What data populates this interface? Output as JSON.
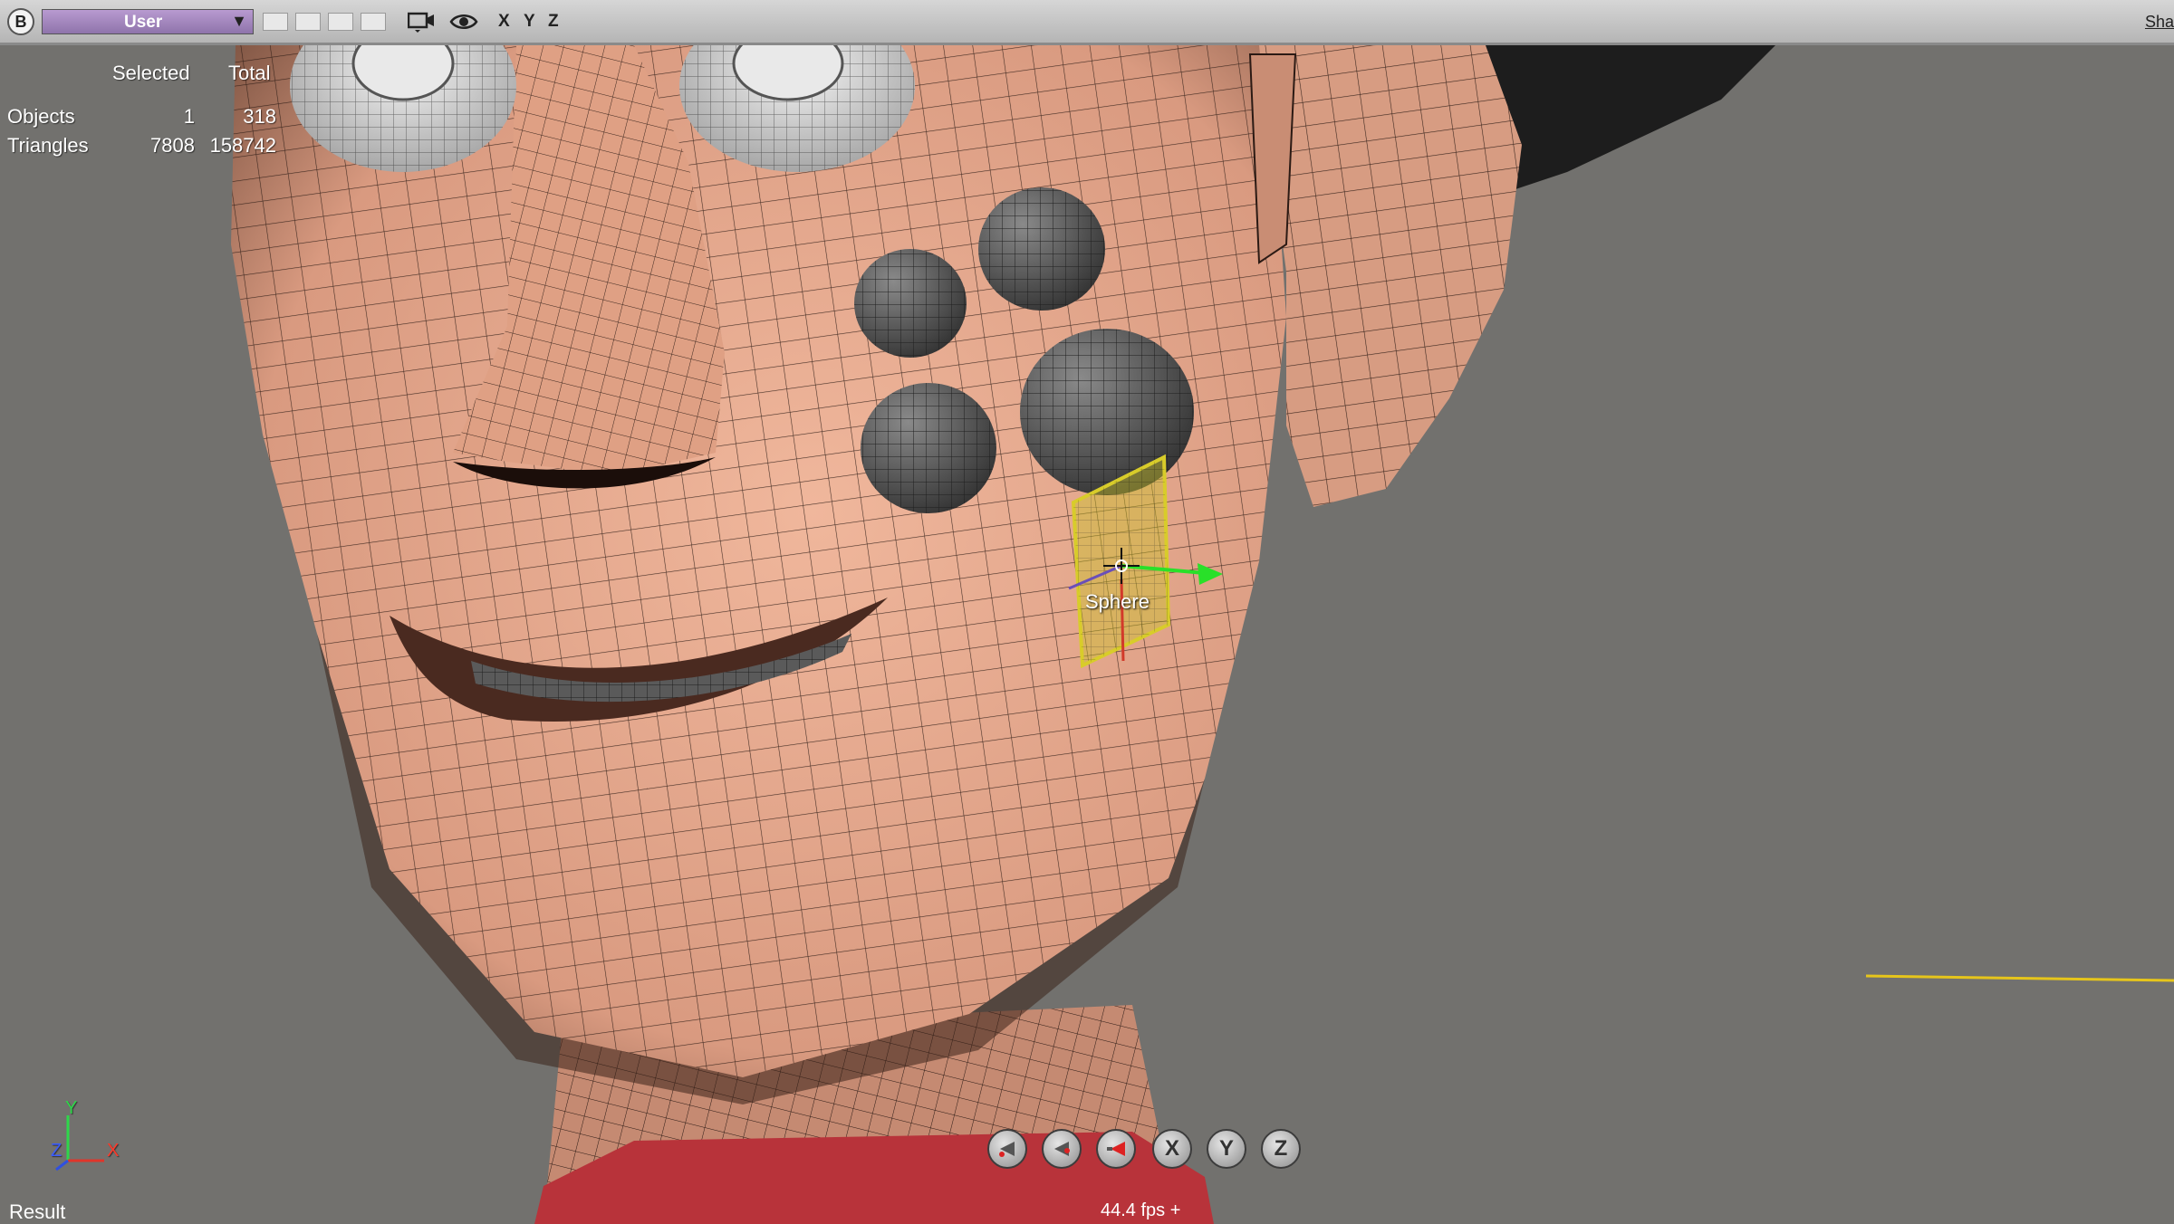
{
  "toolbar": {
    "logo": "B",
    "view_mode": "User",
    "axes": [
      "X",
      "Y",
      "Z"
    ],
    "right_label": "Sha",
    "icons": [
      "dropdown-arrow-icon",
      "camera-icon",
      "eye-icon"
    ]
  },
  "stats": {
    "headers": {
      "selected": "Selected",
      "total": "Total"
    },
    "rows": [
      {
        "label": "Objects",
        "selected": "1",
        "total": "318"
      },
      {
        "label": "Triangles",
        "selected": "7808",
        "total": "158742"
      }
    ]
  },
  "viewport": {
    "selected_object": "Sphere",
    "gizmo_axes": {
      "y": "Y",
      "z": "Z",
      "x": "X"
    },
    "nav_buttons": [
      "X",
      "Y",
      "Z"
    ],
    "colors": {
      "background": "#72716e",
      "skin": "#e4a98e",
      "selection": "#d8cc2a",
      "gizmo_green": "#29e029"
    }
  },
  "status": {
    "result": "Result",
    "fps": "44.4 fps +"
  }
}
